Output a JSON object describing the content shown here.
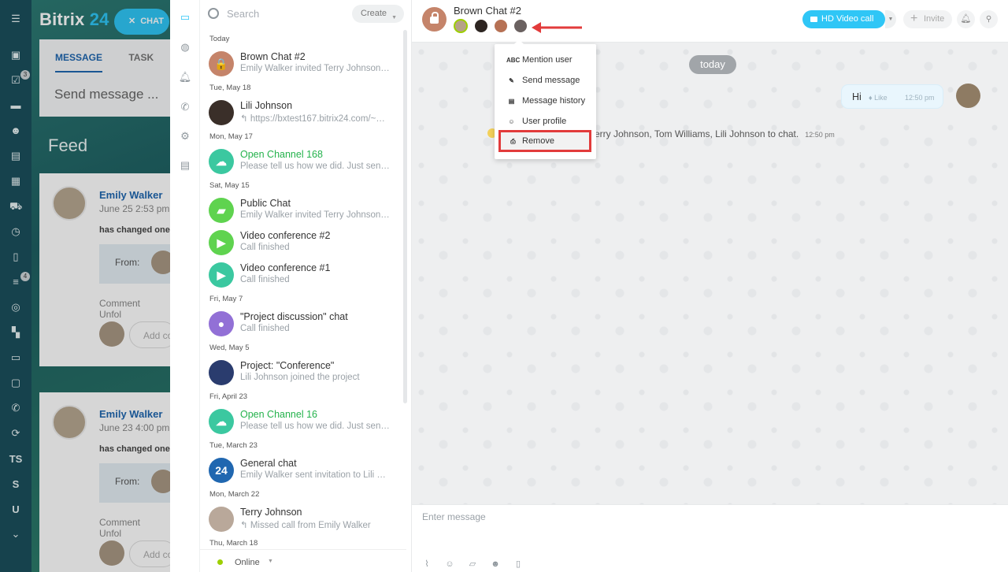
{
  "portal": {
    "logo_prefix": "Bitrix",
    "logo_suffix": "24",
    "chat_button": "CHAT",
    "tabs": [
      "MESSAGE",
      "TASK"
    ],
    "send_message": "Send message ...",
    "feed_title": "Feed",
    "nav_badges": {
      "tasks": "3",
      "filter": "4"
    },
    "nav_letters": [
      "TS",
      "S",
      "U"
    ],
    "posts": [
      {
        "author": "Emily Walker",
        "date": "June 25 2:53 pm",
        "changed": "has changed one",
        "from": "From:",
        "comment": "Comment",
        "unfollow": "Unfol",
        "add": "Add co"
      },
      {
        "author": "Emily Walker",
        "date": "June 23 4:00 pm",
        "changed": "has changed one",
        "from": "From:",
        "comment": "Comment",
        "unfollow": "Unfol",
        "add": "Add co"
      }
    ]
  },
  "recent": {
    "search_placeholder": "Search",
    "create_label": "Create",
    "status": "Online",
    "groups": [
      {
        "date": "Today",
        "items": [
          {
            "title": "Brown Chat #2",
            "sub": "Emily Walker invited Terry Johnson…",
            "color": "#c5846a",
            "glyph": "🔒"
          }
        ]
      },
      {
        "date": "Tue, May 18",
        "items": [
          {
            "title": "Lili Johnson",
            "sub": "↰ https://bxtest167.bitrix24.com/~…",
            "color": "#3a2f29",
            "glyph": ""
          }
        ]
      },
      {
        "date": "Mon, May 17",
        "items": [
          {
            "title": "Open Channel 168",
            "sub": "Please tell us how we did. Just sen…",
            "color": "#3bc8a0",
            "glyph": "☁",
            "green": true
          }
        ]
      },
      {
        "date": "Sat, May 15",
        "items": [
          {
            "title": "Public Chat",
            "sub": "Emily Walker invited Terry Johnson…",
            "color": "#5fd34f",
            "glyph": "▰"
          },
          {
            "title": "Video conference #2",
            "sub": "Call finished",
            "color": "#5fd34f",
            "glyph": "▶"
          },
          {
            "title": "Video conference #1",
            "sub": "Call finished",
            "color": "#3bc8a0",
            "glyph": "▶"
          }
        ]
      },
      {
        "date": "Fri, May 7",
        "items": [
          {
            "title": "\"Project discussion\" chat",
            "sub": "Call finished",
            "color": "#9270d6",
            "glyph": "●"
          }
        ]
      },
      {
        "date": "Wed, May 5",
        "items": [
          {
            "title": "Project: \"Conference\"",
            "sub": "Lili Johnson joined the project",
            "color": "#2a3c6e",
            "glyph": ""
          }
        ]
      },
      {
        "date": "Fri, April 23",
        "items": [
          {
            "title": "Open Channel 16",
            "sub": "Please tell us how we did. Just sen…",
            "color": "#3bc8a0",
            "glyph": "☁",
            "green": true
          }
        ]
      },
      {
        "date": "Tue, March 23",
        "items": [
          {
            "title": "General chat",
            "sub": "Emily Walker sent invitation to Lili J…",
            "color": "#2067b0",
            "glyph": "24"
          }
        ]
      },
      {
        "date": "Mon, March 22",
        "items": [
          {
            "title": "Terry Johnson",
            "sub": "↰ Missed call from Emily Walker",
            "color": "#b9a89a",
            "glyph": ""
          }
        ]
      },
      {
        "date": "Thu, March 18",
        "items": []
      }
    ]
  },
  "chat": {
    "title": "Brown Chat #2",
    "hd_video_call": "HD Video call",
    "invite": "Invite",
    "date_pill": "today",
    "message": {
      "text": "Hi",
      "like": "Like",
      "time": "12:50 pm"
    },
    "system_message": "erry Johnson, Tom Williams, Lili Johnson to chat.",
    "system_time": "12:50 pm",
    "input_placeholder": "Enter message"
  },
  "context_menu": {
    "items": [
      {
        "label": "Mention user",
        "icon": "ABC"
      },
      {
        "label": "Send message",
        "icon": "✎"
      },
      {
        "label": "Message history",
        "icon": "▤"
      },
      {
        "label": "User profile",
        "icon": "☺"
      },
      {
        "label": "Remove",
        "icon": "⎙"
      }
    ]
  },
  "colors": {
    "accent": "#2fc6f6",
    "highlight": "#e23b3b",
    "channel_green": "#24b24c"
  }
}
